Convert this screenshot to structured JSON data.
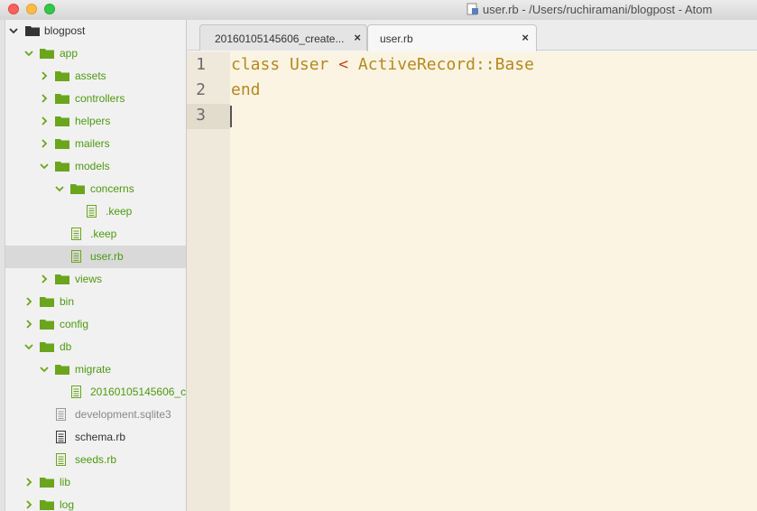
{
  "window": {
    "title": "user.rb - /Users/ruchiramani/blogpost - Atom"
  },
  "tabs": [
    {
      "label": "20160105145606_create...",
      "active": false
    },
    {
      "label": "user.rb",
      "active": true
    }
  ],
  "tree": {
    "root": "blogpost",
    "items": [
      {
        "label": "app"
      },
      {
        "label": "assets"
      },
      {
        "label": "controllers"
      },
      {
        "label": "helpers"
      },
      {
        "label": "mailers"
      },
      {
        "label": "models"
      },
      {
        "label": "concerns"
      },
      {
        "label": ".keep"
      },
      {
        "label": ".keep"
      },
      {
        "label": "user.rb",
        "selected": true
      },
      {
        "label": "views"
      },
      {
        "label": "bin"
      },
      {
        "label": "config"
      },
      {
        "label": "db"
      },
      {
        "label": "migrate"
      },
      {
        "label": "20160105145606_c"
      },
      {
        "label": "development.sqlite3"
      },
      {
        "label": "schema.rb"
      },
      {
        "label": "seeds.rb"
      },
      {
        "label": "lib"
      },
      {
        "label": "log"
      }
    ]
  },
  "editor": {
    "line_numbers": [
      "1",
      "2",
      "3"
    ],
    "code": {
      "kw_class": "class",
      "class_name": "User",
      "op": "<",
      "parent": "ActiveRecord::Base",
      "kw_end": "end"
    }
  },
  "colors": {
    "folder_green": "#6aa51d",
    "label_green": "#4d9a0f",
    "editor_bg": "#fcf4e3",
    "keyword": "#b58920",
    "operator": "#cb4b16"
  }
}
